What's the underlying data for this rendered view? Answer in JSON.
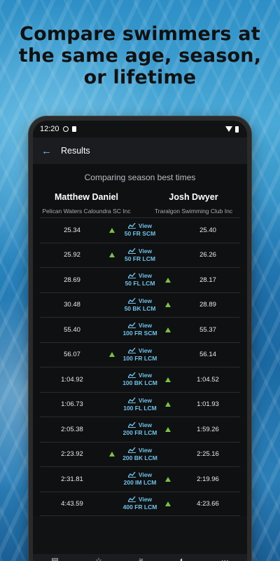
{
  "headline": {
    "line1": "Compare swimmers at",
    "line2": "the same age, season,",
    "line3": "or lifetime"
  },
  "status_bar": {
    "time": "12:20"
  },
  "app_bar": {
    "title": "Results"
  },
  "comparison": {
    "subtitle": "Comparing season best times",
    "left_swimmer": {
      "name": "Matthew Daniel",
      "club": "Pelican Waters Caloundra SC Inc"
    },
    "right_swimmer": {
      "name": "Josh Dwyer",
      "club": "Traralgon Swimming Club Inc"
    },
    "view_label": "View",
    "rows": [
      {
        "left": "25.34",
        "event": "50 FR SCM",
        "right": "25.40",
        "better": "left"
      },
      {
        "left": "25.92",
        "event": "50 FR LCM",
        "right": "26.26",
        "better": "left"
      },
      {
        "left": "28.69",
        "event": "50 FL LCM",
        "right": "28.17",
        "better": "right"
      },
      {
        "left": "30.48",
        "event": "50 BK LCM",
        "right": "28.89",
        "better": "right"
      },
      {
        "left": "55.40",
        "event": "100 FR SCM",
        "right": "55.37",
        "better": "right"
      },
      {
        "left": "56.07",
        "event": "100 FR LCM",
        "right": "56.14",
        "better": "left"
      },
      {
        "left": "1:04.92",
        "event": "100 BK LCM",
        "right": "1:04.52",
        "better": "right"
      },
      {
        "left": "1:06.73",
        "event": "100 FL LCM",
        "right": "1:01.93",
        "better": "right"
      },
      {
        "left": "2:05.38",
        "event": "200 FR LCM",
        "right": "1:59.26",
        "better": "right"
      },
      {
        "left": "2:23.92",
        "event": "200 BK LCM",
        "right": "2:25.16",
        "better": "left"
      },
      {
        "left": "2:31.81",
        "event": "200 IM LCM",
        "right": "2:19.96",
        "better": "right"
      },
      {
        "left": "4:43.59",
        "event": "400 FR LCM",
        "right": "4:23.66",
        "better": "right"
      }
    ]
  },
  "bottom_nav": {
    "items": [
      {
        "icon": "list-icon"
      },
      {
        "icon": "star-icon"
      },
      {
        "icon": "swimmer-icon"
      },
      {
        "icon": "compare-icon"
      },
      {
        "icon": "more-icon"
      }
    ]
  },
  "colors": {
    "accent": "#6ec3e8",
    "better": "#7cc242"
  }
}
